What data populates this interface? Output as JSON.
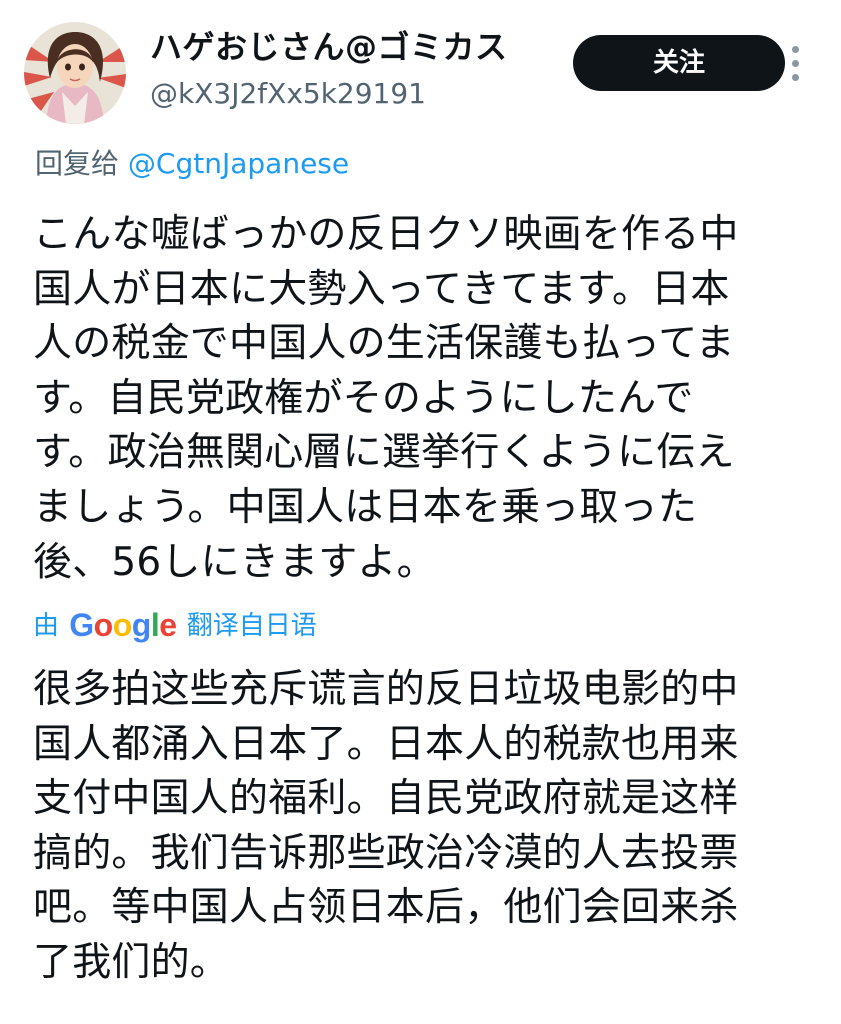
{
  "header": {
    "display_name": "ハゲおじさん@ゴミカス",
    "handle": "@kX3J2fXx5k29191",
    "follow_label": "关注",
    "more_icon": "more-vertical-icon"
  },
  "reply": {
    "prefix": "回复给",
    "mention": "@CgtnJapanese"
  },
  "post": {
    "lines": [
      "こんな嘘ばっかの反日クソ映画を作る中",
      "国人が日本に大勢入ってきてます。日本",
      "人の税金で中国人の生活保護も払ってま",
      "す。自民党政権がそのようにしたんで",
      "す。政治無関心層に選挙行くように伝え",
      "ましょう。中国人は日本を乗っ取った",
      "後、56しにきますよ。"
    ]
  },
  "translation_note": {
    "prefix": "由",
    "brand": "Google",
    "suffix": "翻译自日语"
  },
  "translation": {
    "lines": [
      "很多拍这些充斥谎言的反日垃圾电影的中",
      "国人都涌入日本了。日本人的税款也用来",
      "支付中国人的福利。自民党政府就是这样",
      "搞的。我们告诉那些政治冷漠的人去投票",
      "吧。等中国人占领日本后，他们会回来杀",
      "了我们的。"
    ]
  },
  "colors": {
    "text": "#0f1419",
    "secondary": "#536471",
    "link": "#1d9bf0",
    "button": "#0f1419"
  }
}
